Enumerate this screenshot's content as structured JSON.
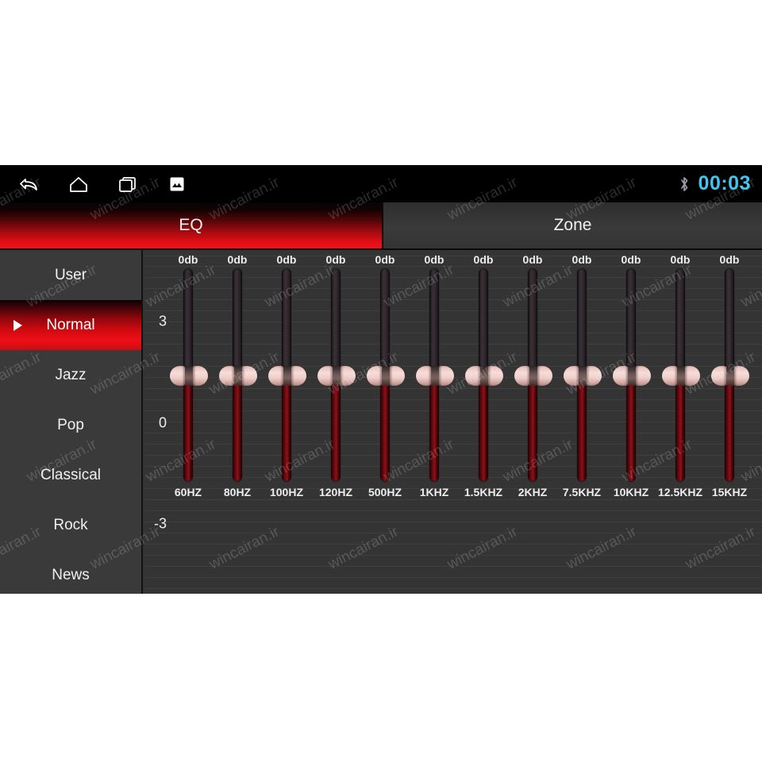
{
  "statusbar": {
    "nav_icons": [
      {
        "name": "back-icon",
        "label": "Back"
      },
      {
        "name": "home-icon",
        "label": "Home"
      },
      {
        "name": "recents-icon",
        "label": "Recents"
      },
      {
        "name": "screenshot-icon",
        "label": "Screenshot"
      }
    ],
    "bluetooth_icon": "bluetooth-icon",
    "clock": "00:03",
    "clock_color": "#3fc6f0",
    "background": "#000000"
  },
  "tabs": [
    {
      "label": "EQ",
      "active": true
    },
    {
      "label": "Zone",
      "active": false
    }
  ],
  "sidebar": {
    "items": [
      {
        "label": "User",
        "selected": false
      },
      {
        "label": "Normal",
        "selected": true
      },
      {
        "label": "Jazz",
        "selected": false
      },
      {
        "label": "Pop",
        "selected": false
      },
      {
        "label": "Classical",
        "selected": false
      },
      {
        "label": "Rock",
        "selected": false
      },
      {
        "label": "News",
        "selected": false
      }
    ],
    "selected_marker": "play-triangle-icon",
    "accent": "#e40f16"
  },
  "equalizer": {
    "axis_labels": [
      "3",
      "0",
      "-3"
    ],
    "value_unit": "db",
    "bands": [
      {
        "freq": "60HZ",
        "value": "0db"
      },
      {
        "freq": "80HZ",
        "value": "0db"
      },
      {
        "freq": "100HZ",
        "value": "0db"
      },
      {
        "freq": "120HZ",
        "value": "0db"
      },
      {
        "freq": "500HZ",
        "value": "0db"
      },
      {
        "freq": "1KHZ",
        "value": "0db"
      },
      {
        "freq": "1.5KHZ",
        "value": "0db"
      },
      {
        "freq": "2KHZ",
        "value": "0db"
      },
      {
        "freq": "7.5KHZ",
        "value": "0db"
      },
      {
        "freq": "10KHZ",
        "value": "0db"
      },
      {
        "freq": "12.5KHZ",
        "value": "0db"
      },
      {
        "freq": "15KHZ",
        "value": "0db"
      }
    ]
  },
  "watermark": {
    "text": "wincairan.ir"
  }
}
